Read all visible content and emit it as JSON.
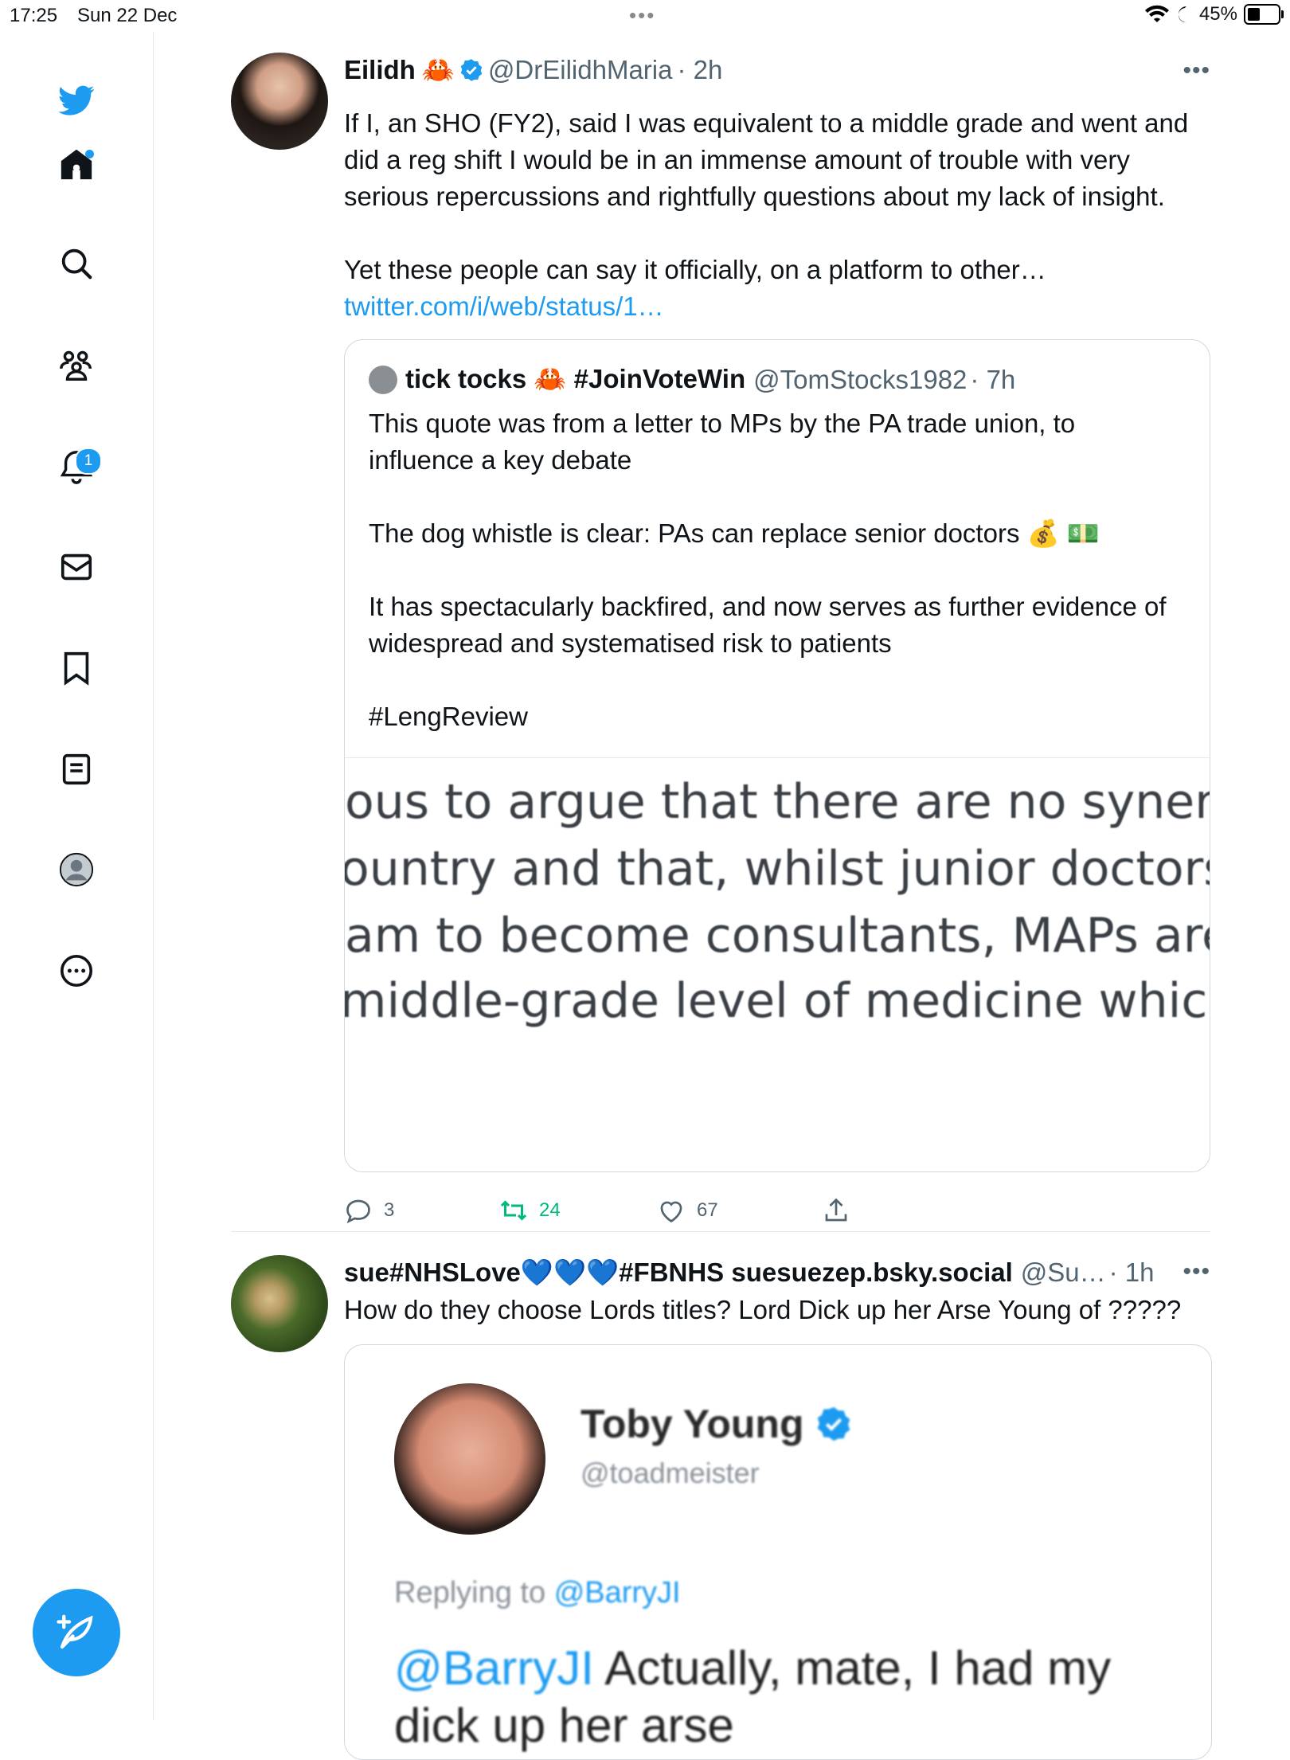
{
  "status_bar": {
    "time": "17:25",
    "date": "Sun 22 Dec",
    "battery": "45%",
    "battery_level": 0.45
  },
  "sidebar": {
    "items": [
      {
        "name": "home",
        "badge": ""
      },
      {
        "name": "explore",
        "badge": ""
      },
      {
        "name": "communities",
        "badge": ""
      },
      {
        "name": "notifications",
        "badge": "1"
      },
      {
        "name": "messages",
        "badge": ""
      },
      {
        "name": "bookmarks",
        "badge": ""
      },
      {
        "name": "lists",
        "badge": ""
      },
      {
        "name": "profile",
        "badge": ""
      },
      {
        "name": "more",
        "badge": ""
      }
    ]
  },
  "tweet1": {
    "name": "Eilidh",
    "emoji": "🦀",
    "handle": "@DrEilidhMaria",
    "time": "· 2h",
    "text": "If I, an SHO (FY2), said I was equivalent to a middle grade and went and did a reg shift I would be in an immense amount of trouble with very serious repercussions and rightfully questions about my lack of insight.\n\nYet these people can say it officially, on a platform to other…",
    "link": "twitter.com/i/web/status/1…",
    "quote": {
      "name": "tick tocks 🦀 #JoinVoteWin",
      "handle": "@TomStocks1982",
      "time": "· 7h",
      "text": "This quote was from a letter to MPs by the PA trade union, to influence a key debate\n\nThe dog whistle is clear: PAs can replace senior doctors 💰 💵\n\nIt has spectacularly backfired, and now serves as further evidence of widespread  and systematised risk to patients\n\n#LengReview",
      "image_lines": [
        "ous to argue that there are no synerg",
        "ountry and that, whilst junior doctors",
        "am to become consultants, MAPs are",
        "middle-grade level of medicine which"
      ]
    },
    "actions": {
      "replies": "3",
      "retweets": "24",
      "likes": "67"
    }
  },
  "tweet2": {
    "name": "sue#NHSLove💙💙💙#FBNHS suesuezep.bsky.social",
    "handle": "@Su…",
    "time": "· 1h",
    "text": "How do they choose Lords titles? Lord Dick up her Arse Young of ?????",
    "image": {
      "name": "Toby Young",
      "handle": "@toadmeister",
      "replying_label": "Replying to",
      "replying_to": "@BarryJI",
      "mention": "@BarryJI",
      "message": " Actually, mate, I had my\ndick up her arse"
    }
  }
}
